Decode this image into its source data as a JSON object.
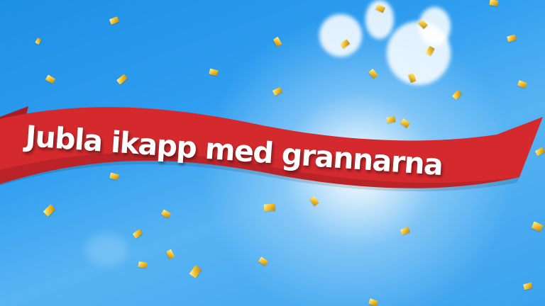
{
  "banner": {
    "text": "Jubla ikapp med grannarna"
  },
  "colors": {
    "ribbon": "#d42a2e",
    "ribbon_dark": "#a81c22",
    "sky": "#2f9ef0",
    "confetti": "#f2c230"
  }
}
